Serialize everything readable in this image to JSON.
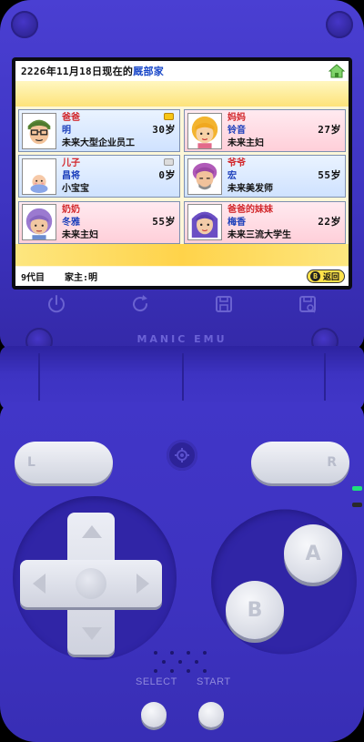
{
  "header": {
    "date": "2226年11月18日现在的",
    "place": "厩部家"
  },
  "family": [
    {
      "role": "爸爸",
      "name": "明",
      "age": "30岁",
      "future": "未来大型企业员工",
      "theme": "blue",
      "badge": "gold"
    },
    {
      "role": "妈妈",
      "name": "铃音",
      "age": "27岁",
      "future": "未来主妇",
      "theme": "pink",
      "badge": ""
    },
    {
      "role": "儿子",
      "name": "昌将",
      "age": "0岁",
      "future": "小宝宝",
      "theme": "blue",
      "badge": "grey"
    },
    {
      "role": "爷爷",
      "name": "宏",
      "age": "55岁",
      "future": "未来美发师",
      "theme": "blue",
      "badge": ""
    },
    {
      "role": "奶奶",
      "name": "冬雅",
      "age": "55岁",
      "future": "未来主妇",
      "theme": "pink",
      "badge": ""
    },
    {
      "role": "爸爸的妹妹",
      "name": "梅香",
      "age": "22岁",
      "future": "未来三流大学生",
      "theme": "pink",
      "badge": ""
    }
  ],
  "footer": {
    "generation": "9代目",
    "head_label": "家主:明",
    "back_key": "B",
    "back_label": "返回"
  },
  "brand": "MANIC EMU",
  "controls": {
    "l": "L",
    "r": "R",
    "a": "A",
    "b": "B",
    "select": "SELECT",
    "start": "START"
  },
  "colors": {
    "shell": "#3d33c0",
    "card_blue": "#cfe2ff",
    "card_pink": "#ffcfd9",
    "role_text": "#d2262a",
    "name_text": "#1c3fbb"
  },
  "toolbar_icons": [
    "power-icon",
    "restart-icon",
    "save-state-icon",
    "load-state-icon"
  ]
}
